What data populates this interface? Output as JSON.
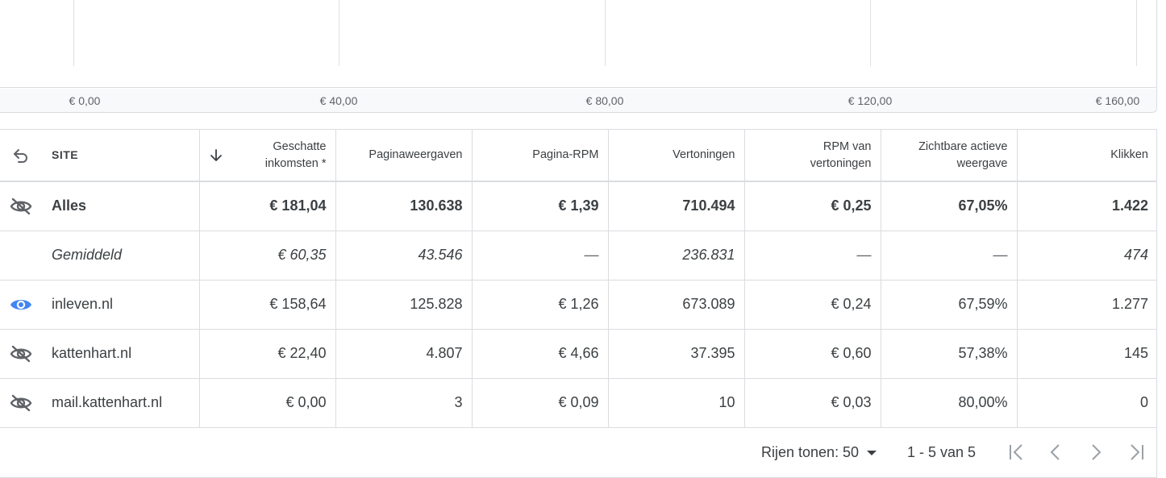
{
  "chart_data": {
    "type": "bar",
    "orientation": "horizontal",
    "x_ticks": [
      "€ 0,00",
      "€ 40,00",
      "€ 80,00",
      "€ 120,00",
      "€ 160,00"
    ],
    "xlim": [
      0,
      160
    ],
    "grid": true
  },
  "chart": {
    "ticks": [
      "€ 0,00",
      "€ 40,00",
      "€ 80,00",
      "€ 120,00",
      "€ 160,00"
    ]
  },
  "table": {
    "headers": {
      "site": "SITE",
      "earnings": "Geschatte inkomsten *",
      "pageviews": "Paginaweergaven",
      "page_rpm": "Pagina-RPM",
      "impressions": "Vertoningen",
      "impression_rpm": "RPM van vertoningen",
      "active_view": "Zichtbare actieve weergave",
      "clicks": "Klikken"
    },
    "total": {
      "site": "Alles",
      "earnings": "€ 181,04",
      "pageviews": "130.638",
      "page_rpm": "€ 1,39",
      "impressions": "710.494",
      "impression_rpm": "€ 0,25",
      "active_view": "67,05%",
      "clicks": "1.422"
    },
    "average": {
      "site": "Gemiddeld",
      "earnings": "€ 60,35",
      "pageviews": "43.546",
      "page_rpm": "—",
      "impressions": "236.831",
      "impression_rpm": "—",
      "active_view": "—",
      "clicks": "474"
    },
    "rows": [
      {
        "visibility": "eye-icon",
        "site": "inleven.nl",
        "earnings": "€ 158,64",
        "pageviews": "125.828",
        "page_rpm": "€ 1,26",
        "impressions": "673.089",
        "impression_rpm": "€ 0,24",
        "active_view": "67,59%",
        "clicks": "1.277"
      },
      {
        "visibility": "eye-off-icon",
        "site": "kattenhart.nl",
        "earnings": "€ 22,40",
        "pageviews": "4.807",
        "page_rpm": "€ 4,66",
        "impressions": "37.395",
        "impression_rpm": "€ 0,60",
        "active_view": "57,38%",
        "clicks": "145"
      },
      {
        "visibility": "eye-off-icon",
        "site": "mail.kattenhart.nl",
        "earnings": "€ 0,00",
        "pageviews": "3",
        "page_rpm": "€ 0,09",
        "impressions": "10",
        "impression_rpm": "€ 0,03",
        "active_view": "80,00%",
        "clicks": "0"
      }
    ]
  },
  "pagination": {
    "rows_label": "Rijen tonen:",
    "rows_value": "50",
    "range": "1 - 5 van 5"
  },
  "colors": {
    "accent": "#4285f4",
    "icon_muted": "#5f6368",
    "border": "#dadce0"
  }
}
